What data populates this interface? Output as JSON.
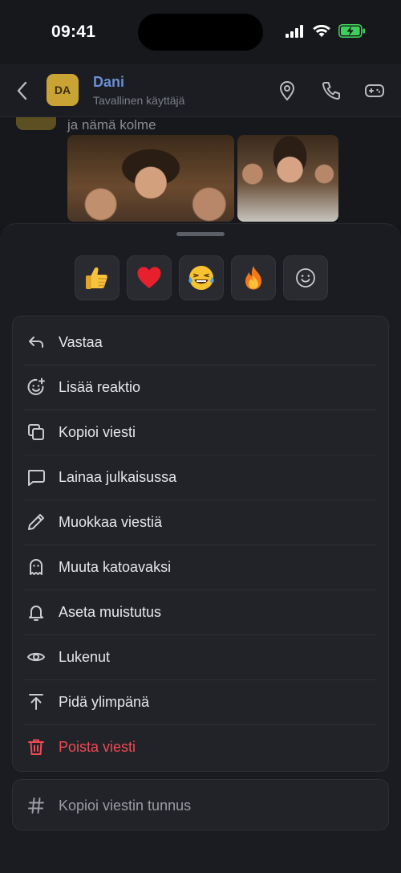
{
  "status": {
    "time": "09:41"
  },
  "header": {
    "avatar_initials": "DA",
    "name": "Dani",
    "role": "Tavallinen käyttäjä"
  },
  "chat": {
    "message_text": "ja nämä kolme"
  },
  "reactions": [
    {
      "icon": "thumbs-up-emoji",
      "glyph": "👍"
    },
    {
      "icon": "heart-emoji",
      "glyph": "❤️"
    },
    {
      "icon": "laughing-emoji",
      "glyph": "😂"
    },
    {
      "icon": "fire-emoji",
      "glyph": "🔥"
    },
    {
      "icon": "add-reaction-smiley-icon",
      "glyph": "☺"
    }
  ],
  "menu": {
    "items": [
      {
        "label": "Vastaa",
        "icon": "reply-icon"
      },
      {
        "label": "Lisää reaktio",
        "icon": "add-reaction-icon"
      },
      {
        "label": "Kopioi viesti",
        "icon": "copy-icon"
      },
      {
        "label": "Lainaa julkaisussa",
        "icon": "quote-icon"
      },
      {
        "label": "Muokkaa viestiä",
        "icon": "edit-icon"
      },
      {
        "label": "Muuta katoavaksi",
        "icon": "ghost-icon"
      },
      {
        "label": "Aseta muistutus",
        "icon": "bell-icon"
      },
      {
        "label": "Lukenut",
        "icon": "eye-icon"
      },
      {
        "label": "Pidä ylimpänä",
        "icon": "pin-top-icon"
      },
      {
        "label": "Poista viesti",
        "icon": "trash-icon"
      }
    ],
    "copy_id_label": "Kopioi viestin tunnus"
  },
  "colors": {
    "danger": "#ef4a52",
    "accent_name": "#6a8fd4",
    "avatar": "#c9a434",
    "battery_charging": "#3ecf5a"
  }
}
